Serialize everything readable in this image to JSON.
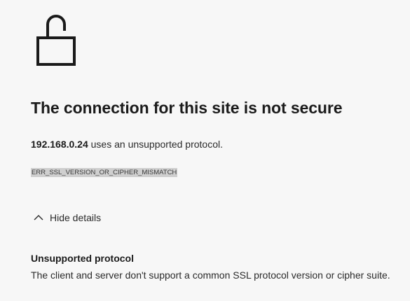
{
  "icon": "lock-open-icon",
  "title": "The connection for this site is not secure",
  "description": {
    "host": "192.168.0.24",
    "text": " uses an unsupported protocol."
  },
  "error_code": "ERR_SSL_VERSION_OR_CIPHER_MISMATCH",
  "details_toggle": {
    "icon": "chevron-up-icon",
    "label": "Hide details"
  },
  "details": {
    "heading": "Unsupported protocol",
    "body": "The client and server don't support a common SSL protocol version or cipher suite."
  }
}
